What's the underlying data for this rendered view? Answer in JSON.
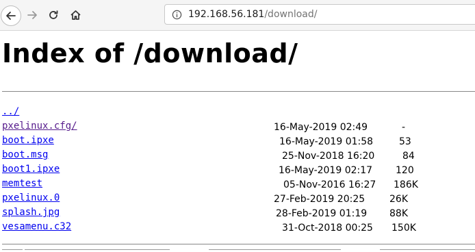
{
  "browser": {
    "url_host": "192.168.56.181",
    "url_path": "/download/"
  },
  "page": {
    "title": "Index of /download/"
  },
  "entries": [
    {
      "name": "../",
      "date": "",
      "size": ""
    },
    {
      "name": "pxelinux.cfg/",
      "date": "16-May-2019  02:49",
      "size": "-"
    },
    {
      "name": "boot.ipxe",
      "date": "16-May-2019  01:58",
      "size": "53"
    },
    {
      "name": "boot.msg",
      "date": "25-Nov-2018  16:20",
      "size": "84"
    },
    {
      "name": "boot1.ipxe",
      "date": "16-May-2019  02:17",
      "size": "120"
    },
    {
      "name": "memtest",
      "date": "05-Nov-2016  16:27",
      "size": "186K"
    },
    {
      "name": "pxelinux.0",
      "date": "27-Feb-2019  20:25",
      "size": "26K"
    },
    {
      "name": "splash.jpg",
      "date": "28-Feb-2019  01:19",
      "size": "88K"
    },
    {
      "name": "vesamenu.c32",
      "date": "31-Oct-2018  00:25",
      "size": "150K"
    }
  ],
  "icons": {
    "back": "arrow-left-icon",
    "forward": "arrow-right-icon",
    "reload": "reload-icon",
    "home": "home-icon",
    "info": "info-icon"
  }
}
